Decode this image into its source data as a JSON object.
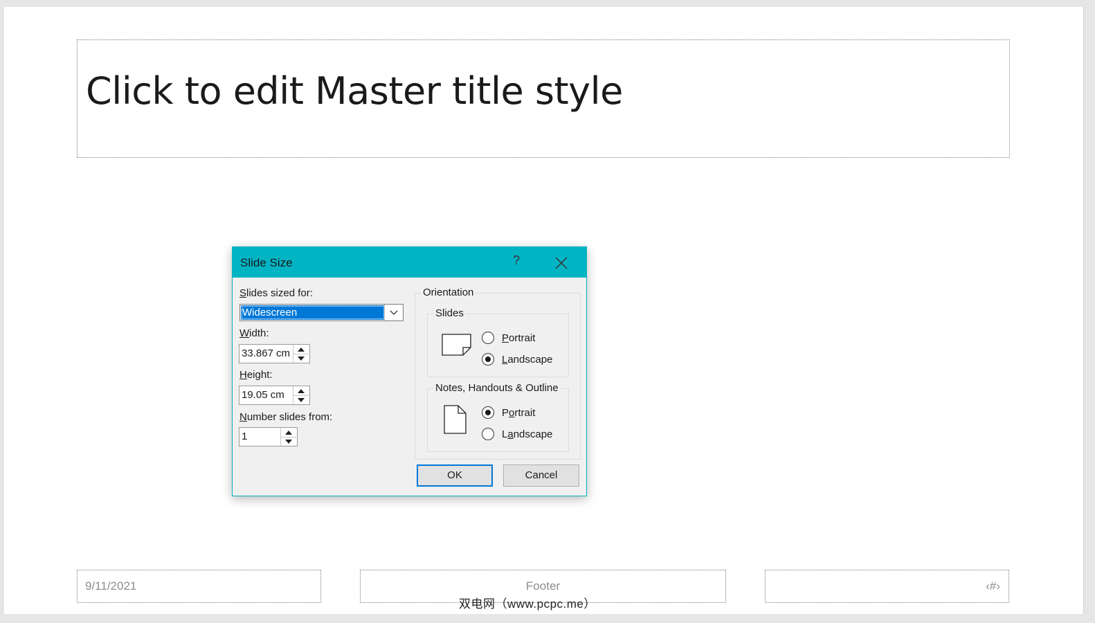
{
  "slide": {
    "title_placeholder": "Click to edit Master title style",
    "date_placeholder": "9/11/2021",
    "footer_placeholder": "Footer",
    "slide_number_placeholder": "‹#›"
  },
  "watermark": "双电网（www.pcpc.me）",
  "dialog": {
    "title": "Slide Size",
    "help_label": "?",
    "close_icon": "close-icon",
    "sized_for_label": {
      "mnemonic": "S",
      "rest": "lides sized for:"
    },
    "sized_for_value": "Widescreen",
    "width_label": {
      "mnemonic": "W",
      "rest": "idth:"
    },
    "width_value": "33.867 cm",
    "height_label": {
      "mnemonic": "H",
      "rest": "eight:"
    },
    "height_value": "19.05 cm",
    "number_from_label": {
      "mnemonic": "N",
      "rest": "umber slides from:"
    },
    "number_from_value": "1",
    "orientation": {
      "title": "Orientation",
      "slides": {
        "title": "Slides",
        "portrait": {
          "mnemonic": "P",
          "rest": "ortrait",
          "selected": false
        },
        "landscape": {
          "mnemonic": "L",
          "rest": "andscape",
          "selected": true
        }
      },
      "notes": {
        "title": "Notes, Handouts & Outline",
        "portrait": {
          "pre": "P",
          "mnemonic": "o",
          "rest": "rtrait",
          "selected": true
        },
        "landscape": {
          "pre": "L",
          "mnemonic": "a",
          "rest": "ndscape",
          "selected": false
        }
      }
    },
    "ok_label": "OK",
    "cancel_label": "Cancel"
  },
  "colors": {
    "dialog_titlebar": "#00b4c4",
    "selection": "#0078d7"
  }
}
